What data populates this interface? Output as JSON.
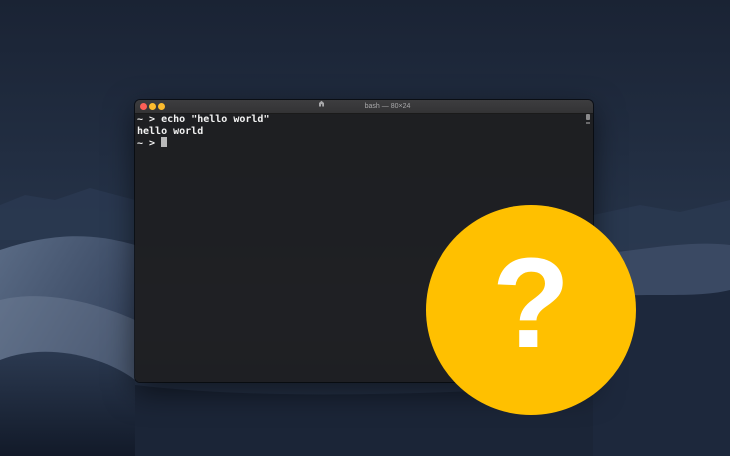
{
  "window": {
    "title": "bash — 80×24"
  },
  "terminal": {
    "lines": [
      {
        "prompt": "~ > ",
        "text": "echo \"hello world\""
      },
      {
        "prompt": "",
        "text": "hello world"
      },
      {
        "prompt": "~ > ",
        "text": ""
      }
    ]
  },
  "colors": {
    "traffic_close": "#fc5f57",
    "traffic_minimize": "#fdbc2e",
    "traffic_zoom": "#fdbc2e",
    "badge_fill": "#ffc000",
    "badge_glyph": "#ffffff",
    "terminal_bg": "#1e1e20"
  },
  "badge": {
    "glyph": "?",
    "icon": "question-mark-icon"
  }
}
